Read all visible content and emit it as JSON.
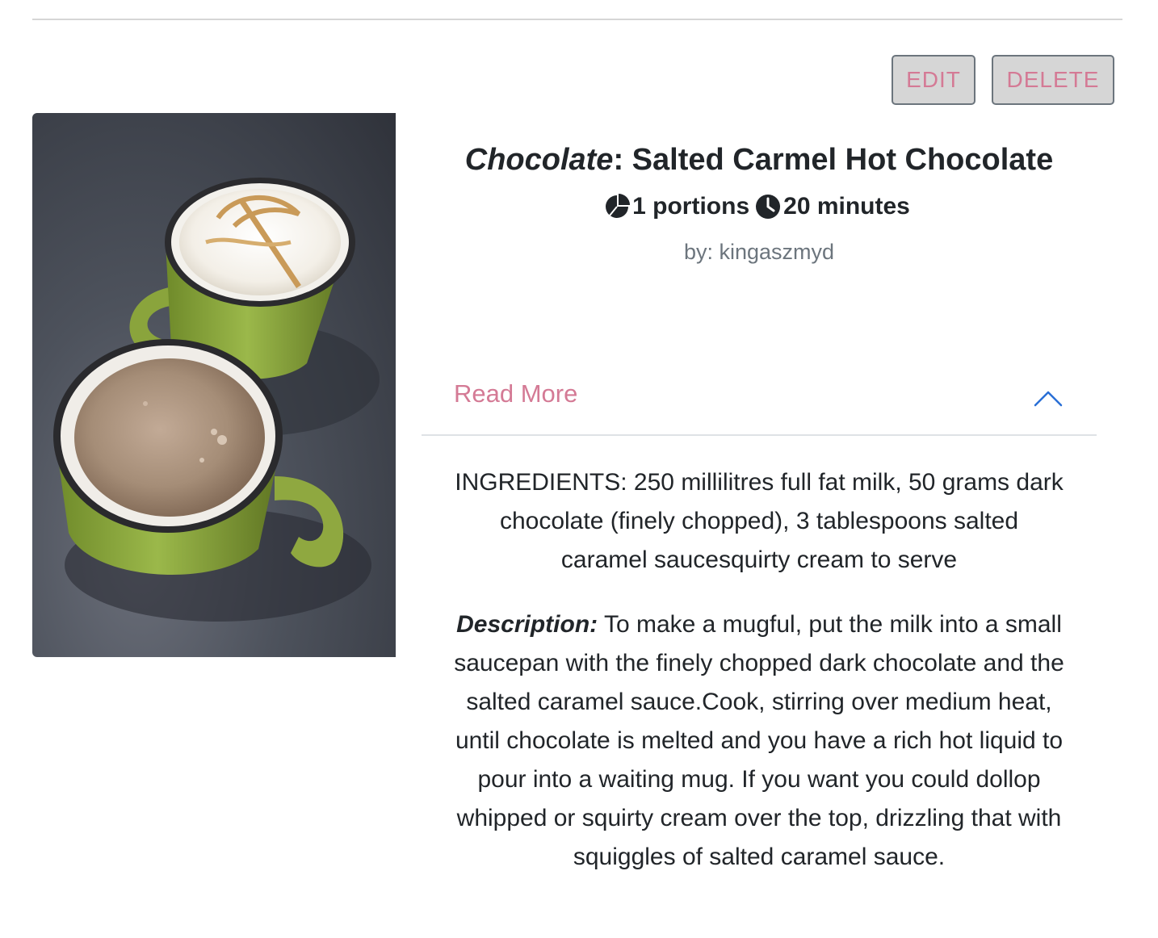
{
  "toolbar": {
    "edit_label": "EDIT",
    "delete_label": "DELETE"
  },
  "recipe": {
    "category": "Chocolate",
    "separator": ":",
    "name": " Salted Carmel Hot Chocolate",
    "portions": "1 portions",
    "time": "20 minutes",
    "author": "by: kingaszmyd",
    "icons": {
      "portions": "pie-chart-icon",
      "time": "clock-icon"
    }
  },
  "accordion": {
    "label": "Read More",
    "state": "expanded",
    "ingredients": "INGREDIENTS: 250 millilitres full fat milk, 50 grams dark chocolate (finely chopped), 3 tablespoons salted caramel saucesquirty cream to serve",
    "description_label": "Description:",
    "description": " To make a mugful, put the milk into a small saucepan with the finely chopped dark chocolate and the salted caramel sauce.Cook, stirring over medium heat, until chocolate is melted and you have a rich hot liquid to pour into a waiting mug. If you want you could dollop whipped or squirty cream over the top, drizzling that with squiggles of salted caramel sauce."
  },
  "colors": {
    "accent_pink": "#d47a95",
    "chevron_blue": "#2a6fd6",
    "button_bg": "#d6d6d6",
    "muted_text": "#6c757d"
  }
}
